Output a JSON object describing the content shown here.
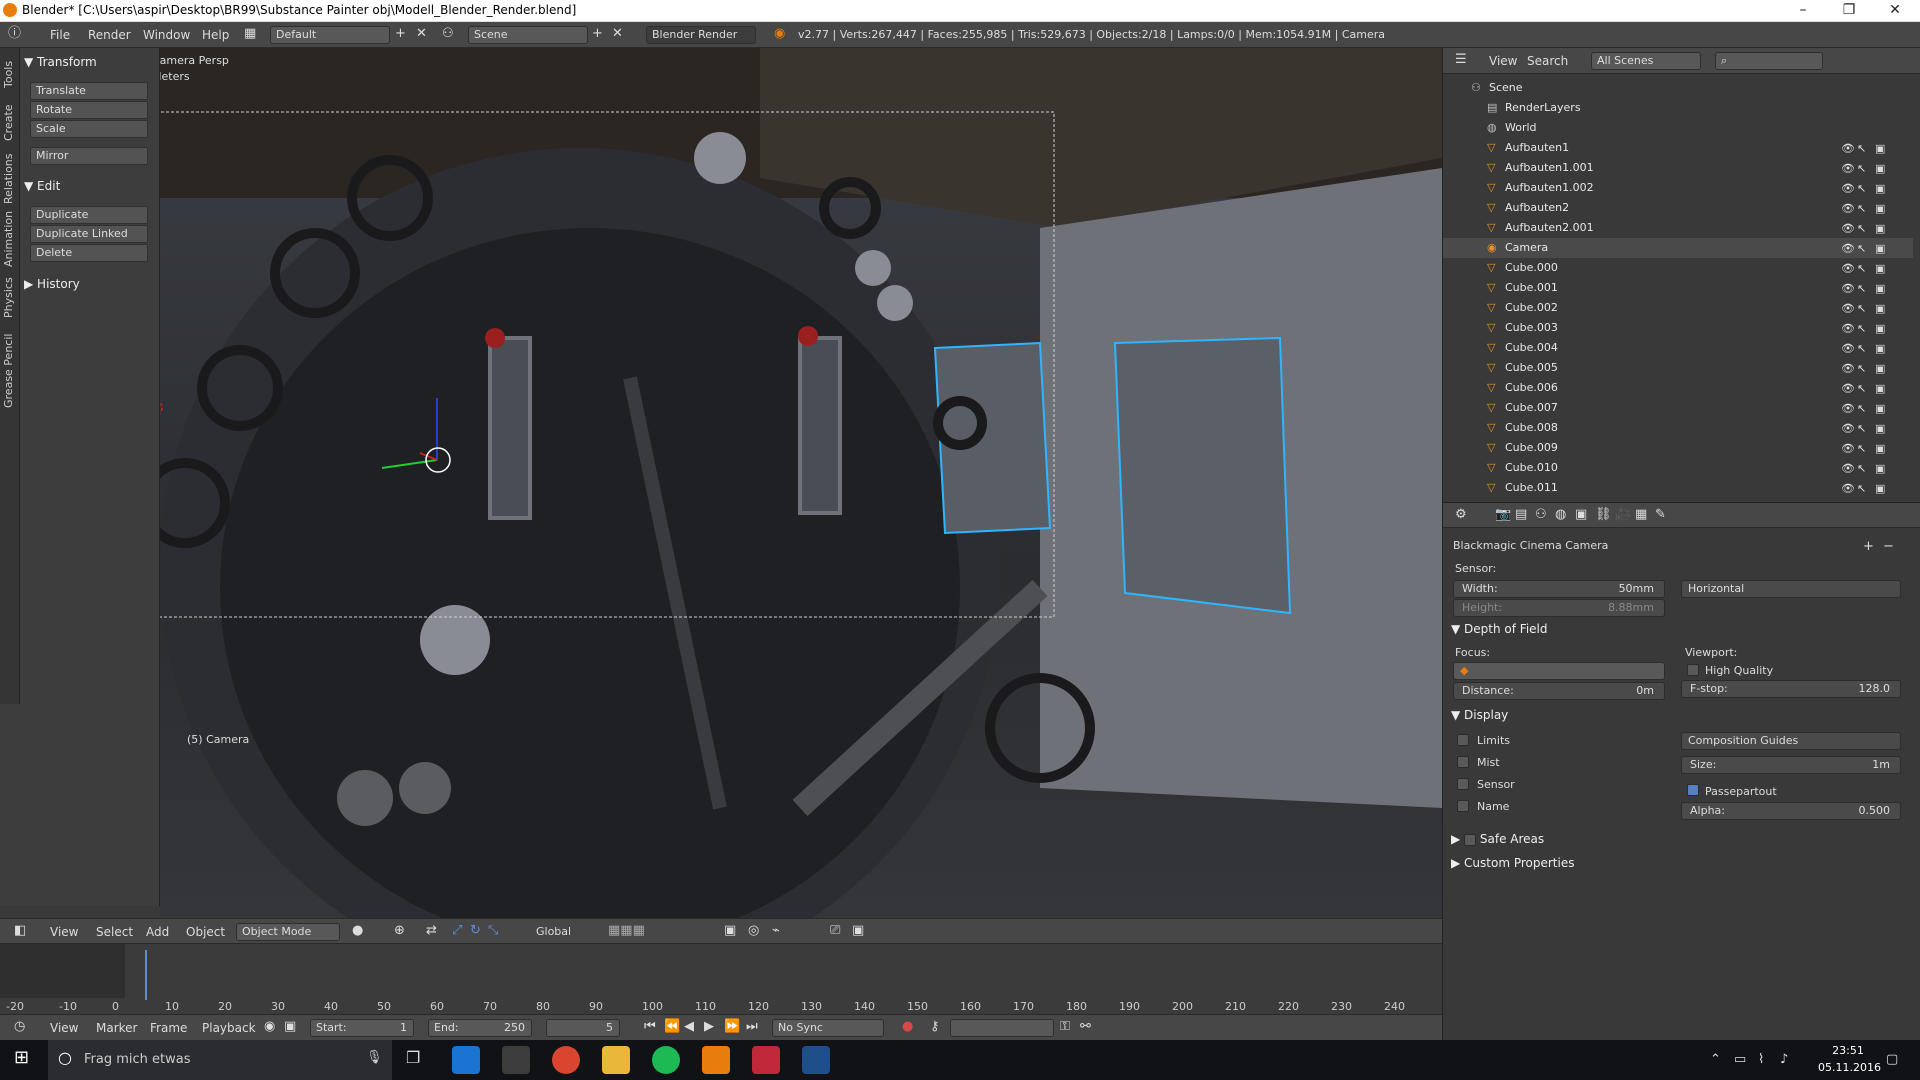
{
  "window": {
    "title": "Blender* [C:\\Users\\aspir\\Desktop\\BR99\\Substance Painter obj\\Modell_Blender_Render.blend]",
    "controls": [
      "–",
      "❐",
      "✕"
    ]
  },
  "infobar": {
    "menus": [
      "File",
      "Render",
      "Window",
      "Help"
    ],
    "layout": "Default",
    "scene": "Scene",
    "engine": "Blender Render",
    "stats": "v2.77 | Verts:267,447 | Faces:255,985 | Tris:529,673 | Objects:2/18 | Lamps:0/0 | Mem:1054.91M | Camera"
  },
  "toolshelf": {
    "tabs": [
      "Tools",
      "Create",
      "Relations",
      "Animation",
      "Physics",
      "Grease Pencil"
    ],
    "transform": {
      "title": "Transform",
      "buttons": [
        "Translate",
        "Rotate",
        "Scale",
        "Mirror"
      ]
    },
    "edit": {
      "title": "Edit",
      "buttons": [
        "Duplicate",
        "Duplicate Linked",
        "Delete"
      ]
    },
    "history": {
      "title": "History"
    }
  },
  "viewport": {
    "view_name": "Camera Persp",
    "units": "Meters",
    "object_label": "(5) Camera"
  },
  "view3d_header": {
    "menus": [
      "View",
      "Select",
      "Add",
      "Object"
    ],
    "mode": "Object Mode",
    "orientation": "Global"
  },
  "timeline": {
    "ticks": [
      "-20",
      "-10",
      "0",
      "10",
      "20",
      "30",
      "40",
      "50",
      "60",
      "70",
      "80",
      "90",
      "100",
      "110",
      "120",
      "130",
      "140",
      "150",
      "160",
      "170",
      "180",
      "190",
      "200",
      "210",
      "220",
      "230",
      "240"
    ],
    "menus": [
      "View",
      "Marker",
      "Frame",
      "Playback"
    ],
    "start_label": "Start:",
    "start": "1",
    "end_label": "End:",
    "end": "250",
    "current": "5",
    "sync": "No Sync"
  },
  "outliner": {
    "menus": [
      "View",
      "Search"
    ],
    "filter": "All Scenes",
    "items": [
      {
        "name": "Scene",
        "indent": 0,
        "kind": "scene"
      },
      {
        "name": "RenderLayers",
        "indent": 1,
        "kind": "layers"
      },
      {
        "name": "World",
        "indent": 1,
        "kind": "world"
      },
      {
        "name": "Aufbauten1",
        "indent": 1,
        "kind": "mesh"
      },
      {
        "name": "Aufbauten1.001",
        "indent": 1,
        "kind": "mesh"
      },
      {
        "name": "Aufbauten1.002",
        "indent": 1,
        "kind": "mesh"
      },
      {
        "name": "Aufbauten2",
        "indent": 1,
        "kind": "mesh"
      },
      {
        "name": "Aufbauten2.001",
        "indent": 1,
        "kind": "mesh"
      },
      {
        "name": "Camera",
        "indent": 1,
        "kind": "camera"
      },
      {
        "name": "Cube.000",
        "indent": 1,
        "kind": "mesh"
      },
      {
        "name": "Cube.001",
        "indent": 1,
        "kind": "mesh"
      },
      {
        "name": "Cube.002",
        "indent": 1,
        "kind": "mesh"
      },
      {
        "name": "Cube.003",
        "indent": 1,
        "kind": "mesh"
      },
      {
        "name": "Cube.004",
        "indent": 1,
        "kind": "mesh"
      },
      {
        "name": "Cube.005",
        "indent": 1,
        "kind": "mesh"
      },
      {
        "name": "Cube.006",
        "indent": 1,
        "kind": "mesh"
      },
      {
        "name": "Cube.007",
        "indent": 1,
        "kind": "mesh"
      },
      {
        "name": "Cube.008",
        "indent": 1,
        "kind": "mesh"
      },
      {
        "name": "Cube.009",
        "indent": 1,
        "kind": "mesh"
      },
      {
        "name": "Cube.010",
        "indent": 1,
        "kind": "mesh"
      },
      {
        "name": "Cube.011",
        "indent": 1,
        "kind": "mesh"
      }
    ]
  },
  "properties": {
    "preset": "Blackmagic Cinema Camera",
    "sensor_label": "Sensor:",
    "width_label": "Width:",
    "width": "50mm",
    "height_label": "Height:",
    "height": "8.88mm",
    "fit": "Horizontal",
    "dof": {
      "title": "Depth of Field",
      "focus_label": "Focus:",
      "distance_label": "Distance:",
      "distance": "0m",
      "viewport_label": "Viewport:",
      "high_quality": "High Quality",
      "fstop_label": "F-stop:",
      "fstop": "128.0"
    },
    "display": {
      "title": "Display",
      "limits": "Limits",
      "mist": "Mist",
      "sensor": "Sensor",
      "name": "Name",
      "guides": "Composition Guides",
      "size_label": "Size:",
      "size": "1m",
      "passepartout": "Passepartout",
      "alpha_label": "Alpha:",
      "alpha": "0.500"
    },
    "safe_areas": "Safe Areas",
    "custom_props": "Custom Properties"
  },
  "taskbar": {
    "search": "Frag mich etwas",
    "time": "23:51",
    "date": "05.11.2016"
  },
  "colors": {
    "selected_outline": "#2fb5ff",
    "blender_orange": "#e87d0d",
    "panel_bg": "#393939"
  }
}
